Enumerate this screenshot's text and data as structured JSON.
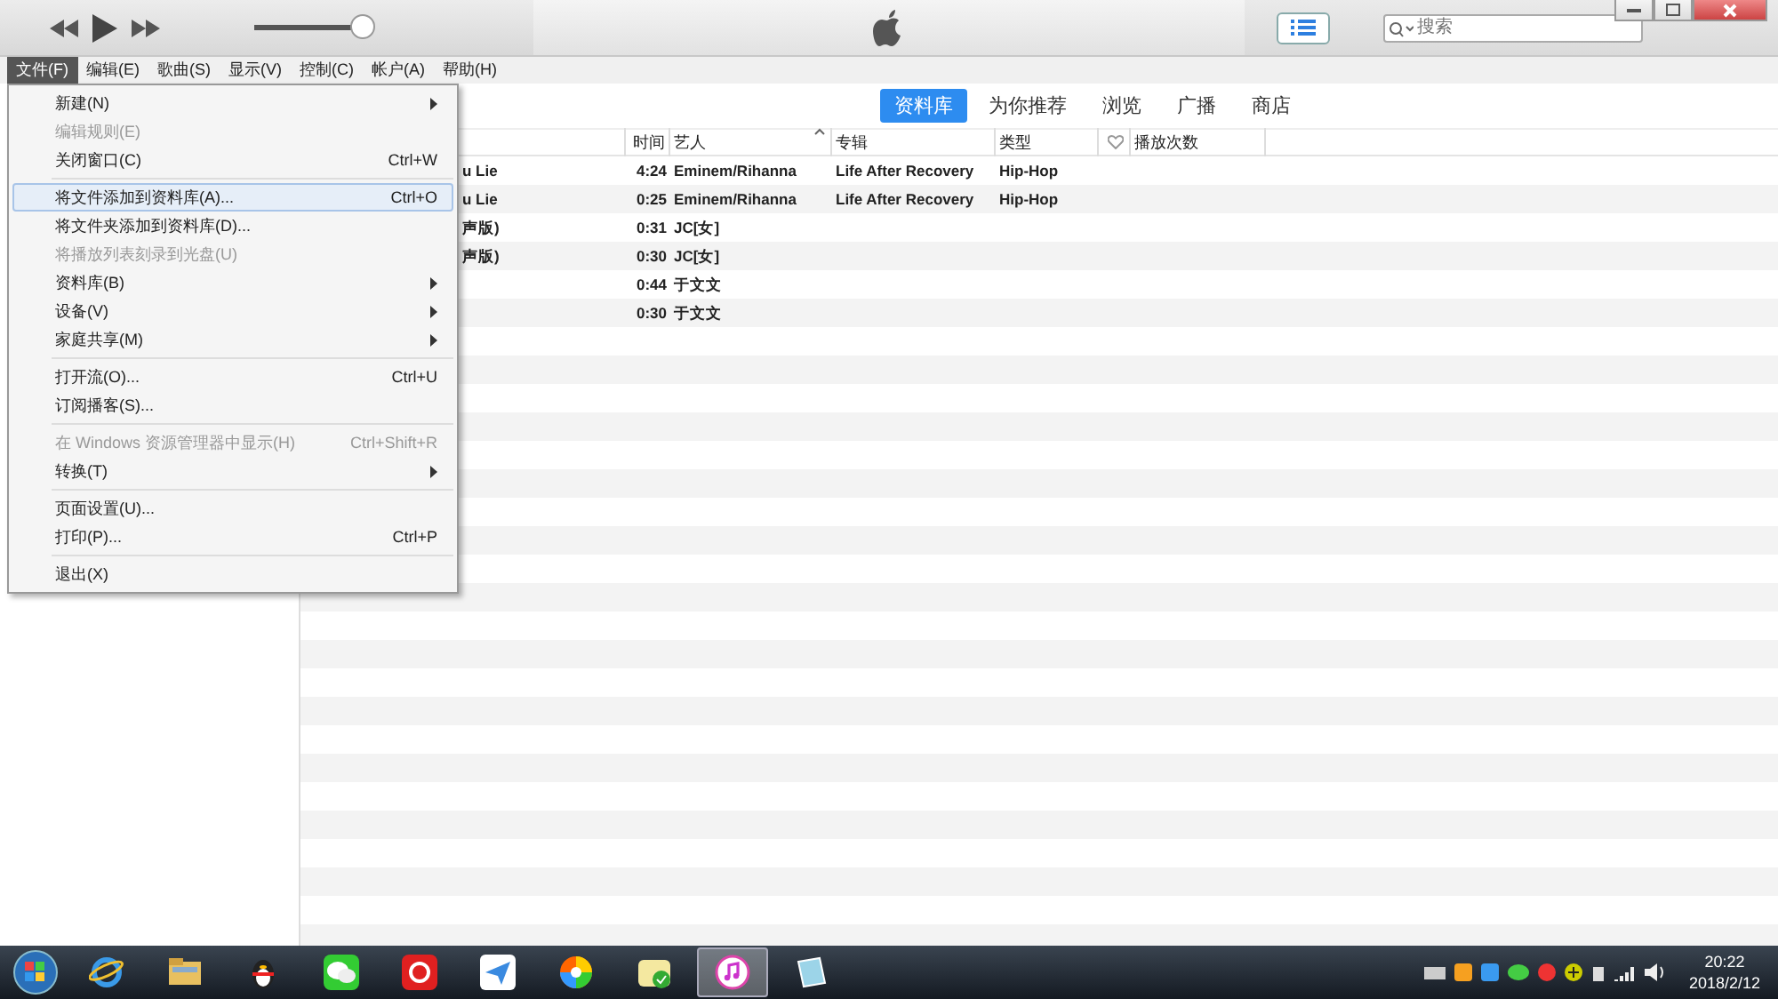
{
  "player": {
    "volume": {
      "level": 0.92
    }
  },
  "view_button": {
    "selected": true
  },
  "search": {
    "placeholder": "搜索"
  },
  "menubar": [
    {
      "label": "文件(F)",
      "selected": true
    },
    {
      "label": "编辑(E)",
      "selected": false
    },
    {
      "label": "歌曲(S)",
      "selected": false
    },
    {
      "label": "显示(V)",
      "selected": false
    },
    {
      "label": "控制(C)",
      "selected": false
    },
    {
      "label": "帐户(A)",
      "selected": false
    },
    {
      "label": "帮助(H)",
      "selected": false
    }
  ],
  "nav_tabs": [
    {
      "label": "资料库",
      "selected": true
    },
    {
      "label": "为你推荐",
      "selected": false
    },
    {
      "label": "浏览",
      "selected": false
    },
    {
      "label": "广播",
      "selected": false
    },
    {
      "label": "商店",
      "selected": false
    }
  ],
  "table": {
    "columns": [
      {
        "label": "时间",
        "kind": "time"
      },
      {
        "label": "艺人",
        "kind": "artist",
        "sorted": true
      },
      {
        "label": "专辑",
        "kind": "album"
      },
      {
        "label": "类型",
        "kind": "genre"
      },
      {
        "kind": "heart"
      },
      {
        "label": "播放次数",
        "kind": "plays"
      }
    ],
    "rows": [
      {
        "title": "u Lie",
        "time": "4:24",
        "artist": "Eminem/Rihanna",
        "album": "Life After Recovery",
        "genre": "Hip-Hop"
      },
      {
        "title": "u Lie",
        "time": "0:25",
        "artist": "Eminem/Rihanna",
        "album": "Life After Recovery",
        "genre": "Hip-Hop"
      },
      {
        "title": "声版)",
        "time": "0:31",
        "artist": "JC[女]"
      },
      {
        "title": "声版)",
        "time": "0:30",
        "artist": "JC[女]"
      },
      {
        "time": "0:44",
        "artist": "于文文"
      },
      {
        "time": "0:30",
        "artist": "于文文"
      }
    ]
  },
  "file_menu": [
    {
      "kind": "item",
      "label": "新建(N)",
      "submenu": true,
      "disabled": false,
      "selected": false
    },
    {
      "kind": "item",
      "label": "编辑规则(E)",
      "disabled": true,
      "selected": false
    },
    {
      "kind": "item",
      "label": "关闭窗口(C)",
      "shortcut": "Ctrl+W",
      "disabled": false,
      "selected": false
    },
    {
      "kind": "separator"
    },
    {
      "kind": "item",
      "label": "将文件添加到资料库(A)...",
      "shortcut": "Ctrl+O",
      "disabled": false,
      "selected": true
    },
    {
      "kind": "item",
      "label": "将文件夹添加到资料库(D)...",
      "disabled": false,
      "selected": false
    },
    {
      "kind": "item",
      "label": "将播放列表刻录到光盘(U)",
      "disabled": true,
      "selected": false
    },
    {
      "kind": "item",
      "label": "资料库(B)",
      "submenu": true,
      "disabled": false,
      "selected": false
    },
    {
      "kind": "item",
      "label": "设备(V)",
      "submenu": true,
      "disabled": false,
      "selected": false
    },
    {
      "kind": "item",
      "label": "家庭共享(M)",
      "submenu": true,
      "disabled": false,
      "selected": false
    },
    {
      "kind": "separator"
    },
    {
      "kind": "item",
      "label": "打开流(O)...",
      "shortcut": "Ctrl+U",
      "disabled": false,
      "selected": false
    },
    {
      "kind": "item",
      "label": "订阅播客(S)...",
      "disabled": false,
      "selected": false
    },
    {
      "kind": "separator"
    },
    {
      "kind": "item",
      "label": "在 Windows 资源管理器中显示(H)",
      "shortcut": "Ctrl+Shift+R",
      "disabled": true,
      "selected": false
    },
    {
      "kind": "item",
      "label": "转换(T)",
      "submenu": true,
      "disabled": false,
      "selected": false
    },
    {
      "kind": "separator"
    },
    {
      "kind": "item",
      "label": "页面设置(U)...",
      "disabled": false,
      "selected": false
    },
    {
      "kind": "item",
      "label": "打印(P)...",
      "shortcut": "Ctrl+P",
      "disabled": false,
      "selected": false
    },
    {
      "kind": "separator"
    },
    {
      "kind": "item",
      "label": "退出(X)",
      "disabled": false,
      "selected": false
    }
  ],
  "taskbar": {
    "apps": [
      {
        "kind": "ie",
        "selected": false
      },
      {
        "kind": "folder",
        "selected": false
      },
      {
        "kind": "penguin",
        "selected": false
      },
      {
        "kind": "chat",
        "selected": false
      },
      {
        "kind": "music-red",
        "selected": false
      },
      {
        "kind": "plane",
        "selected": false
      },
      {
        "kind": "wheel",
        "selected": false
      },
      {
        "kind": "box",
        "selected": false
      },
      {
        "kind": "itunes",
        "selected": true
      },
      {
        "kind": "book",
        "selected": false
      }
    ],
    "time": "20:22",
    "date": "2018/2/12"
  }
}
